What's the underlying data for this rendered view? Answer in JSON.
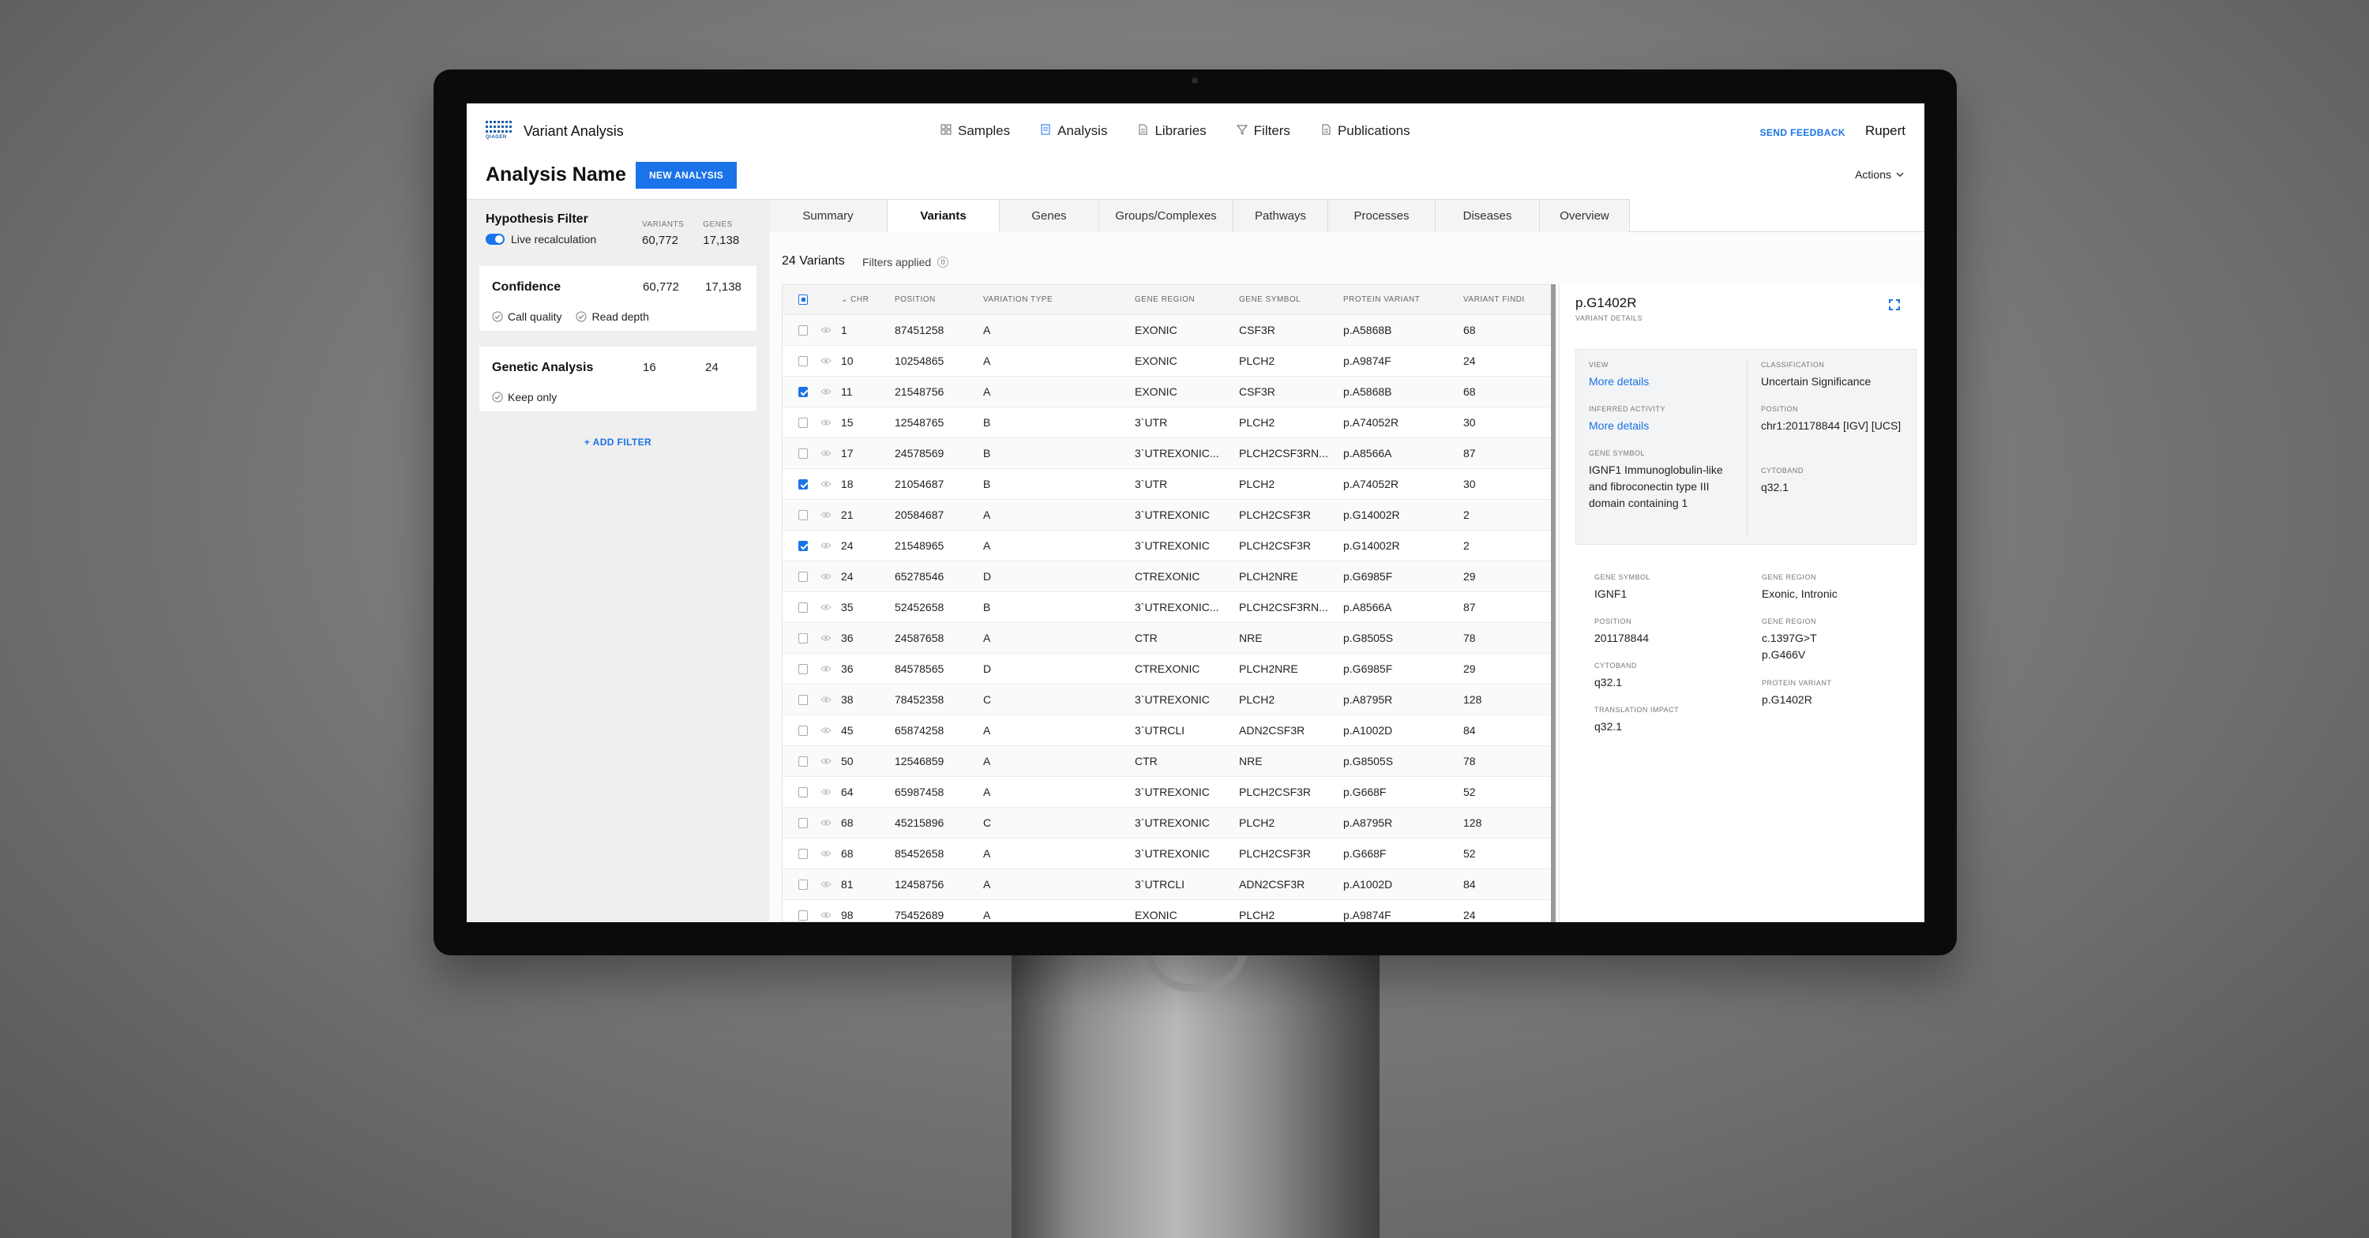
{
  "header": {
    "app_title": "Variant Analysis",
    "logo_text": "QIAGEN",
    "nav": [
      {
        "label": "Samples",
        "icon": "grid-icon"
      },
      {
        "label": "Analysis",
        "icon": "document-icon"
      },
      {
        "label": "Libraries",
        "icon": "file-icon"
      },
      {
        "label": "Filters",
        "icon": "filter-icon"
      },
      {
        "label": "Publications",
        "icon": "file-icon"
      }
    ],
    "feedback": "SEND FEEDBACK",
    "user": "Rupert"
  },
  "page": {
    "title": "Analysis Name",
    "new_button": "NEW ANALYSIS",
    "actions": "Actions"
  },
  "filters": {
    "hypothesis": {
      "title": "Hypothesis Filter",
      "toggle_label": "Live recalculation",
      "variants_label": "VARIANTS",
      "genes_label": "GENES",
      "variants": "60,772",
      "genes": "17,138"
    },
    "cards": [
      {
        "title": "Confidence",
        "v1": "60,772",
        "v2": "17,138",
        "options": [
          "Call quality",
          "Read depth"
        ]
      },
      {
        "title": "Genetic Analysis",
        "v1": "16",
        "v2": "24",
        "options": [
          "Keep only"
        ]
      }
    ],
    "add_filter": "ADD FILTER"
  },
  "tabs": [
    "Summary",
    "Variants",
    "Genes",
    "Groups/Complexes",
    "Pathways",
    "Processes",
    "Diseases",
    "Overview"
  ],
  "active_tab": "Variants",
  "variants": {
    "count_label": "24 Variants",
    "filters_applied": "Filters applied",
    "filters_count": "0",
    "columns": [
      "CHR",
      "POSITION",
      "VARIATION TYPE",
      "GENE REGION",
      "GENE SYMBOL",
      "PROTEIN VARIANT",
      "VARIANT FINDINGS"
    ],
    "rows": [
      {
        "checked": false,
        "chr": "1",
        "pos": "87451258",
        "type": "A",
        "region": "EXONIC",
        "symbol": "CSF3R",
        "protein": "p.A5868B",
        "find": "68"
      },
      {
        "checked": false,
        "chr": "10",
        "pos": "10254865",
        "type": "A",
        "region": "EXONIC",
        "symbol": "PLCH2",
        "protein": "p.A9874F",
        "find": "24"
      },
      {
        "checked": true,
        "chr": "11",
        "pos": "21548756",
        "type": "A",
        "region": "EXONIC",
        "symbol": "CSF3R",
        "protein": "p.A5868B",
        "find": "68"
      },
      {
        "checked": false,
        "chr": "15",
        "pos": "12548765",
        "type": "B",
        "region": "3`UTR",
        "symbol": "PLCH2",
        "protein": "p.A74052R",
        "find": "30"
      },
      {
        "checked": false,
        "chr": "17",
        "pos": "24578569",
        "type": "B",
        "region": "3`UTREXONIC...",
        "symbol": "PLCH2CSF3RN...",
        "protein": "p.A8566A",
        "find": "87"
      },
      {
        "checked": true,
        "chr": "18",
        "pos": "21054687",
        "type": "B",
        "region": "3`UTR",
        "symbol": "PLCH2",
        "protein": "p.A74052R",
        "find": "30"
      },
      {
        "checked": false,
        "chr": "21",
        "pos": "20584687",
        "type": "A",
        "region": "3`UTREXONIC",
        "symbol": "PLCH2CSF3R",
        "protein": "p.G14002R",
        "find": "2"
      },
      {
        "checked": true,
        "chr": "24",
        "pos": "21548965",
        "type": "A",
        "region": "3`UTREXONIC",
        "symbol": "PLCH2CSF3R",
        "protein": "p.G14002R",
        "find": "2"
      },
      {
        "checked": false,
        "chr": "24",
        "pos": "65278546",
        "type": "D",
        "region": "CTREXONIC",
        "symbol": "PLCH2NRE",
        "protein": "p.G6985F",
        "find": "29"
      },
      {
        "checked": false,
        "chr": "35",
        "pos": "52452658",
        "type": "B",
        "region": "3`UTREXONIC...",
        "symbol": "PLCH2CSF3RN...",
        "protein": "p.A8566A",
        "find": "87"
      },
      {
        "checked": false,
        "chr": "36",
        "pos": "24587658",
        "type": "A",
        "region": "CTR",
        "symbol": "NRE",
        "protein": "p.G8505S",
        "find": "78"
      },
      {
        "checked": false,
        "chr": "36",
        "pos": "84578565",
        "type": "D",
        "region": "CTREXONIC",
        "symbol": "PLCH2NRE",
        "protein": "p.G6985F",
        "find": "29"
      },
      {
        "checked": false,
        "chr": "38",
        "pos": "78452358",
        "type": "C",
        "region": "3`UTREXONIC",
        "symbol": "PLCH2",
        "protein": "p.A8795R",
        "find": "128"
      },
      {
        "checked": false,
        "chr": "45",
        "pos": "65874258",
        "type": "A",
        "region": "3`UTRCLI",
        "symbol": "ADN2CSF3R",
        "protein": "p.A1002D",
        "find": "84"
      },
      {
        "checked": false,
        "chr": "50",
        "pos": "12546859",
        "type": "A",
        "region": "CTR",
        "symbol": "NRE",
        "protein": "p.G8505S",
        "find": "78"
      },
      {
        "checked": false,
        "chr": "64",
        "pos": "65987458",
        "type": "A",
        "region": "3`UTREXONIC",
        "symbol": "PLCH2CSF3R",
        "protein": "p.G668F",
        "find": "52"
      },
      {
        "checked": false,
        "chr": "68",
        "pos": "45215896",
        "type": "C",
        "region": "3`UTREXONIC",
        "symbol": "PLCH2",
        "protein": "p.A8795R",
        "find": "128"
      },
      {
        "checked": false,
        "chr": "68",
        "pos": "85452658",
        "type": "A",
        "region": "3`UTREXONIC",
        "symbol": "PLCH2CSF3R",
        "protein": "p.G668F",
        "find": "52"
      },
      {
        "checked": false,
        "chr": "81",
        "pos": "12458756",
        "type": "A",
        "region": "3`UTRCLI",
        "symbol": "ADN2CSF3R",
        "protein": "p.A1002D",
        "find": "84"
      },
      {
        "checked": false,
        "chr": "98",
        "pos": "75452689",
        "type": "A",
        "region": "EXONIC",
        "symbol": "PLCH2",
        "protein": "p.A9874F",
        "find": "24"
      }
    ]
  },
  "detail": {
    "title": "p.G1402R",
    "subtitle": "VARIANT DETAILS",
    "box": {
      "view_label": "VIEW",
      "view_link": "More details",
      "inferred_label": "INFERRED ACTIVITY",
      "inferred_link": "More details",
      "gene_symbol_label": "GENE SYMBOL",
      "gene_symbol": "IGNF1 Immunoglobulin-like and fibroconectin type III domain containing 1",
      "classification_label": "CLASSIFICATION",
      "classification": "Uncertain Significance",
      "position_label": "POSITION",
      "position": "chr1:201178844 [IGV] [UCS]",
      "cytoband_label": "CYTOBAND",
      "cytoband": "q32.1"
    },
    "lower": {
      "gene_symbol_label": "GENE SYMBOL",
      "gene_symbol": "IGNF1",
      "position_label": "POSITION",
      "position": "201178844",
      "cytoband_label": "CYTOBAND",
      "cytoband": "q32.1",
      "translation_label": "TRANSLATION IMPACT",
      "translation": "q32.1",
      "gene_region_label": "GENE REGION",
      "gene_region": "Exonic, Intronic",
      "gene_region2_label": "GENE REGION",
      "gene_region2": "c.1397G>T p.G466V",
      "protein_label": "PROTEIN VARIANT",
      "protein": "p.G1402R"
    }
  }
}
